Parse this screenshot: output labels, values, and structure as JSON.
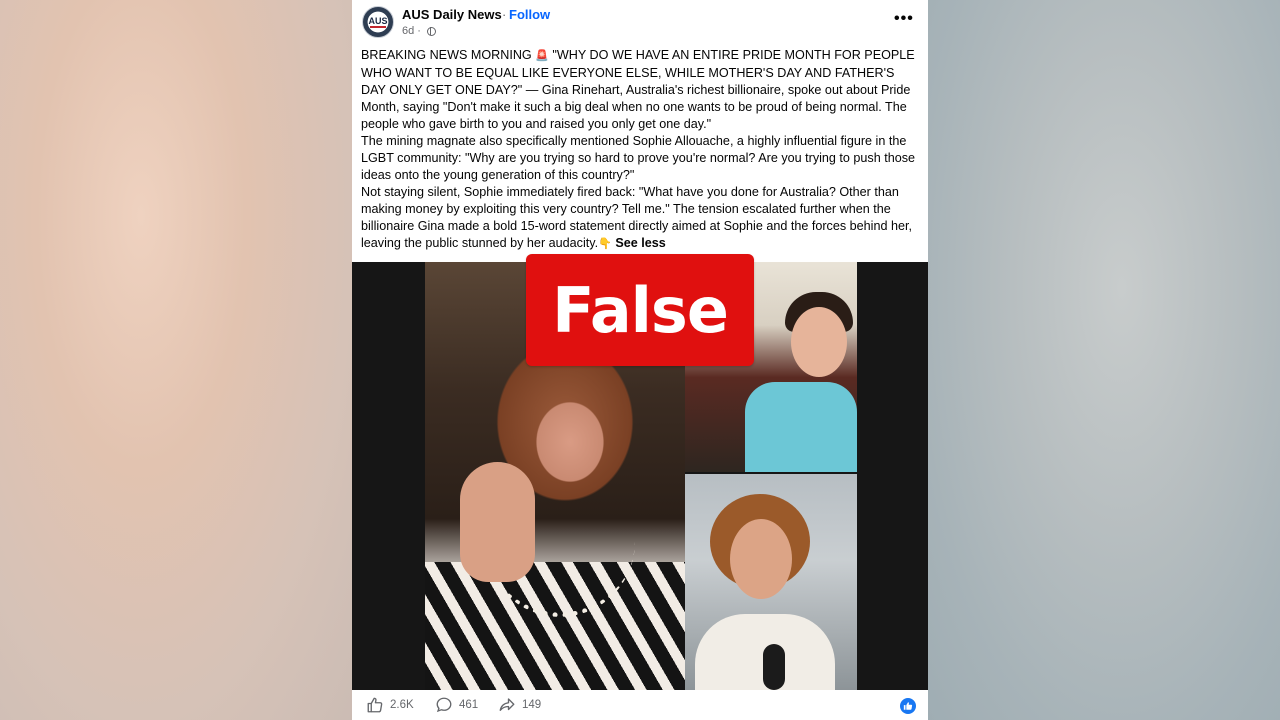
{
  "page": {
    "name": "AUS Daily News",
    "separator": "·",
    "follow_label": "Follow",
    "time_ago": "6d ·",
    "avatar_text": "AUS"
  },
  "post": {
    "paragraphs": [
      {
        "before_emoji": "BREAKING NEWS MORNING ",
        "emoji": "🚨",
        "after_emoji": " \"WHY DO WE HAVE AN ENTIRE PRIDE MONTH FOR PEOPLE WHO WANT TO BE EQUAL LIKE EVERYONE ELSE, WHILE MOTHER'S DAY AND FATHER'S DAY ONLY GET ONE DAY?\" — Gina Rinehart, Australia's richest billionaire, spoke out about Pride Month, saying \"Don't make it such a big deal when no one wants to be proud of being normal. The people who gave birth to you and raised you only get one day.\""
      },
      {
        "text": "The mining magnate also specifically mentioned Sophie Allouache, a highly influential figure in the LGBT community: \"Why are you trying so hard to prove you're normal? Are you trying to push those ideas onto the young generation of this country?\""
      },
      {
        "text": "Not staying silent, Sophie immediately fired back: \"What have you done for Australia? Other than making money by exploiting this very country? Tell me.\" The tension escalated further when the billionaire Gina made a bold 15-word statement directly aimed at Sophie and the forces behind her, leaving the public stunned by her audacity.",
        "emoji": "👇",
        "see_less": "See less"
      }
    ]
  },
  "media": {
    "fact_check_label": "False"
  },
  "engagement": {
    "likes": "2.6K",
    "comments": "461",
    "shares": "149"
  },
  "colors": {
    "follow": "#0866ff",
    "false_badge": "#e0100f",
    "like_badge": "#1877f2"
  },
  "icons": [
    "more-options-icon",
    "globe-icon",
    "like-icon",
    "comment-icon",
    "share-icon",
    "like-reaction-icon"
  ]
}
